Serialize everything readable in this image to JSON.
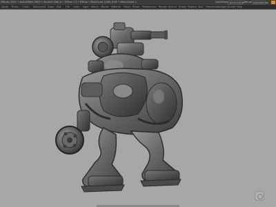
{
  "titlebar": {
    "text": "ZBrush 2021 • ActiveMem 4505 • Scratch Disk 0 • ZTime 1.3 • RTime • PolyCount 2,061.9 KP • MeshCount 1",
    "quicksave": "QuickSave",
    "seethrough": "See-through 0",
    "menus": "Menus",
    "script": "DefaultZScript"
  },
  "menubar": {
    "items": [
      "Alpha",
      "Brush",
      "Color",
      "Document",
      "Draw",
      "Edit",
      "File",
      "Layer",
      "Light",
      "Macro",
      "Marker",
      "Material",
      "Movie",
      "Picker",
      "Preferences",
      "Render",
      "Stencil",
      "Stroke",
      "Texture",
      "Tool",
      "Transform",
      "Zplugin",
      "Zscript",
      "Help"
    ]
  },
  "viewport": {
    "background": "#a7a7a7",
    "model": "robot-mech-sculpt",
    "model_color": "#6a6a6a"
  }
}
